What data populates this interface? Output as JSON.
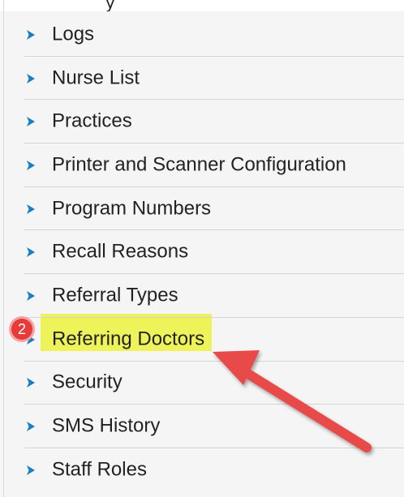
{
  "menu": {
    "items": [
      {
        "label": "Logs"
      },
      {
        "label": "Nurse List"
      },
      {
        "label": "Practices"
      },
      {
        "label": "Printer and Scanner Configuration"
      },
      {
        "label": "Program Numbers"
      },
      {
        "label": "Recall Reasons"
      },
      {
        "label": "Referral Types"
      },
      {
        "label": "Referring Doctors",
        "highlighted": true
      },
      {
        "label": "Security"
      },
      {
        "label": "SMS History"
      },
      {
        "label": "Staff Roles"
      }
    ]
  },
  "annotation": {
    "step_number": "2",
    "badge_color": "#e63b3b",
    "highlight_color": "#eef35a",
    "arrow_color": "#e84a4a"
  },
  "colors": {
    "chevron": "#1a7fc1",
    "text": "#222222",
    "divider": "#d4d4d4"
  },
  "top_strip_text": "y"
}
